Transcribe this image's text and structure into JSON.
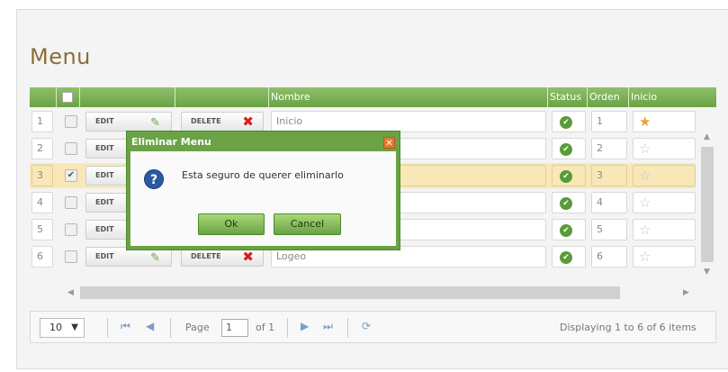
{
  "page_title": "Menu",
  "columns": {
    "nombre": "Nombre",
    "status": "Status",
    "orden": "Orden",
    "inicio": "Inicio"
  },
  "edit_label": "EDIT",
  "delete_label": "DELETE",
  "rows": [
    {
      "num": "1",
      "nombre": "Inicio",
      "orden": "1",
      "checked": false,
      "starred": true
    },
    {
      "num": "2",
      "nombre": "",
      "orden": "2",
      "checked": false,
      "starred": false
    },
    {
      "num": "3",
      "nombre": "",
      "orden": "3",
      "checked": true,
      "starred": false
    },
    {
      "num": "4",
      "nombre": "",
      "orden": "4",
      "checked": false,
      "starred": false
    },
    {
      "num": "5",
      "nombre": "",
      "orden": "5",
      "checked": false,
      "starred": false
    },
    {
      "num": "6",
      "nombre": "Logeo",
      "orden": "6",
      "checked": false,
      "starred": false
    }
  ],
  "pager": {
    "page_size": "10",
    "page_label": "Page",
    "page_value": "1",
    "of_label": "of 1",
    "info": "Displaying 1 to 6 of 6 items"
  },
  "dialog": {
    "title": "Eliminar Menu",
    "message": "Esta seguro de querer eliminarlo",
    "ok": "Ok",
    "cancel": "Cancel"
  },
  "colors": {
    "header": "#6aa245",
    "title": "#8a6e3a",
    "selected_row": "#f8e8b8"
  }
}
